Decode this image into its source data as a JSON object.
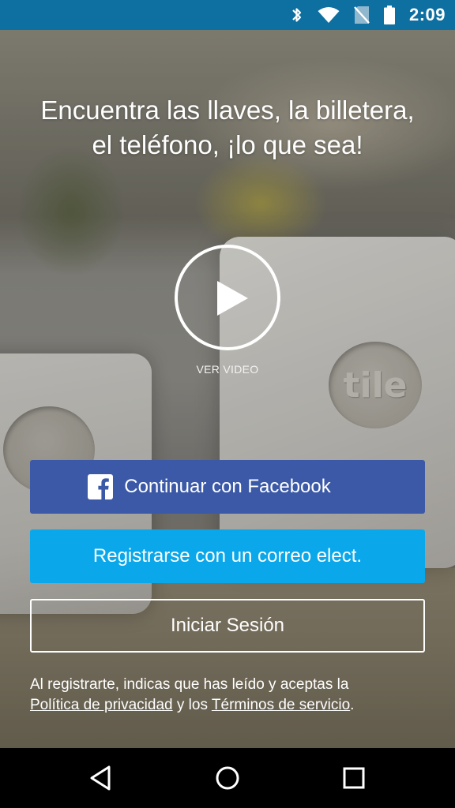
{
  "status_bar": {
    "time": "2:09",
    "icons": [
      "bluetooth-icon",
      "wifi-icon",
      "no-sim-icon",
      "battery-icon"
    ],
    "background": "#0e6fa1"
  },
  "hero": {
    "headline": "Encuentra las llaves, la billetera,\nel teléfono, ¡lo que sea!",
    "video_label": "VER VIDEO",
    "play_icon": "play-icon",
    "background_logo_text": "tile"
  },
  "buttons": {
    "facebook_label": "Continuar con Facebook",
    "facebook_icon": "facebook-icon",
    "facebook_color": "#3b59a6",
    "email_label": "Registrarse con un correo elect.",
    "email_color": "#0aa8ea",
    "login_label": "Iniciar Sesión"
  },
  "legal": {
    "prefix": "Al registrarte, indicas que has leído y aceptas la",
    "privacy_link": "Política de privacidad",
    "connector": " y los ",
    "terms_link": "Términos de servicio",
    "suffix": "."
  },
  "nav_bar": {
    "icons": [
      "back-icon",
      "home-icon",
      "recents-icon"
    ]
  }
}
